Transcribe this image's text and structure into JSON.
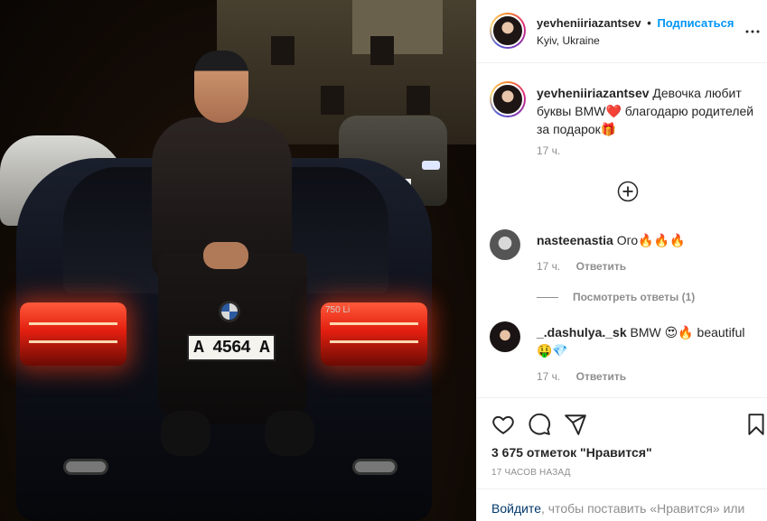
{
  "header": {
    "username": "yevheniiriazantsev",
    "separator": "•",
    "follow_label": "Подписаться",
    "location": "Kyiv, Ukraine"
  },
  "photo": {
    "plate_text": "А 4564 А",
    "model_badge": "750 Li"
  },
  "caption": {
    "username": "yevheniiriazantsev",
    "text": "Девочка любит буквы BMW❤️ благодарю родителей за подарок🎁",
    "time": "17 ч."
  },
  "comments": [
    {
      "username": "nasteenastia",
      "text": "Ого🔥🔥🔥",
      "time": "17 ч.",
      "reply_label": "Ответить",
      "view_replies": "Посмотреть ответы (1)"
    },
    {
      "username": "_.dashulya._sk",
      "text": "BMW 😍🔥 beautiful 🤑💎",
      "time": "17 ч.",
      "reply_label": "Ответить"
    }
  ],
  "actions": {
    "likes": "3 675 отметок \"Нравится\"",
    "time_ago": "17 ЧАСОВ НАЗАД",
    "login_link": "Войдите",
    "login_text": ", чтобы поставить «Нравится» или прокомментировать."
  },
  "icons": {
    "more": "more-horizontal-icon",
    "add": "plus-circle-icon",
    "like": "heart-icon",
    "comment": "comment-icon",
    "share": "share-icon",
    "save": "bookmark-icon"
  }
}
